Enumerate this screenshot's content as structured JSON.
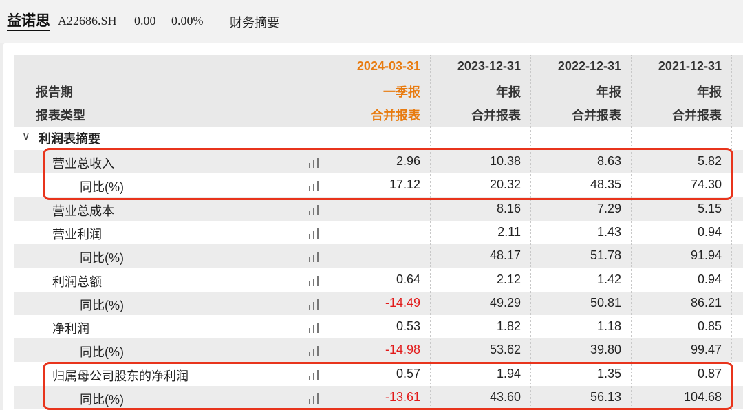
{
  "header": {
    "stock_name": "益诺思",
    "stock_code": "A22686.SH",
    "price": "0.00",
    "change_pct": "0.00%",
    "tab_label": "财务摘要"
  },
  "table": {
    "row_labels": {
      "period": "报告期",
      "type": "报表类型"
    },
    "columns": [
      {
        "date": "2024-03-31",
        "period": "一季报",
        "type": "合并报表"
      },
      {
        "date": "2023-12-31",
        "period": "年报",
        "type": "合并报表"
      },
      {
        "date": "2022-12-31",
        "period": "年报",
        "type": "合并报表"
      },
      {
        "date": "2021-12-31",
        "period": "年报",
        "type": "合并报表"
      }
    ],
    "section": {
      "label": "利润表摘要",
      "chevron": "chevron-down-icon"
    },
    "rows": [
      {
        "label": "营业总收入",
        "values": [
          "2.96",
          "10.38",
          "8.63",
          "5.82"
        ]
      },
      {
        "label": "同比(%)",
        "values": [
          "17.12",
          "20.32",
          "48.35",
          "74.30"
        ]
      },
      {
        "label": "营业总成本",
        "values": [
          "",
          "8.16",
          "7.29",
          "5.15"
        ]
      },
      {
        "label": "营业利润",
        "values": [
          "",
          "2.11",
          "1.43",
          "0.94"
        ]
      },
      {
        "label": "同比(%)",
        "values": [
          "",
          "48.17",
          "51.78",
          "91.94"
        ]
      },
      {
        "label": "利润总额",
        "values": [
          "0.64",
          "2.12",
          "1.42",
          "0.94"
        ]
      },
      {
        "label": "同比(%)",
        "values": [
          "-14.49",
          "49.29",
          "50.81",
          "86.21"
        ]
      },
      {
        "label": "净利润",
        "values": [
          "0.53",
          "1.82",
          "1.18",
          "0.85"
        ]
      },
      {
        "label": "同比(%)",
        "values": [
          "-14.98",
          "53.62",
          "39.80",
          "99.47"
        ]
      },
      {
        "label": "归属母公司股东的净利润",
        "values": [
          "0.57",
          "1.94",
          "1.35",
          "0.87"
        ]
      },
      {
        "label": "同比(%)",
        "values": [
          "-13.61",
          "43.60",
          "56.13",
          "104.68"
        ]
      }
    ]
  },
  "colors": {
    "current_period": "#e87b10",
    "negative": "#e21b1b",
    "highlight": "#e8341c"
  },
  "icons": {
    "chart": "bar-chart-icon"
  }
}
